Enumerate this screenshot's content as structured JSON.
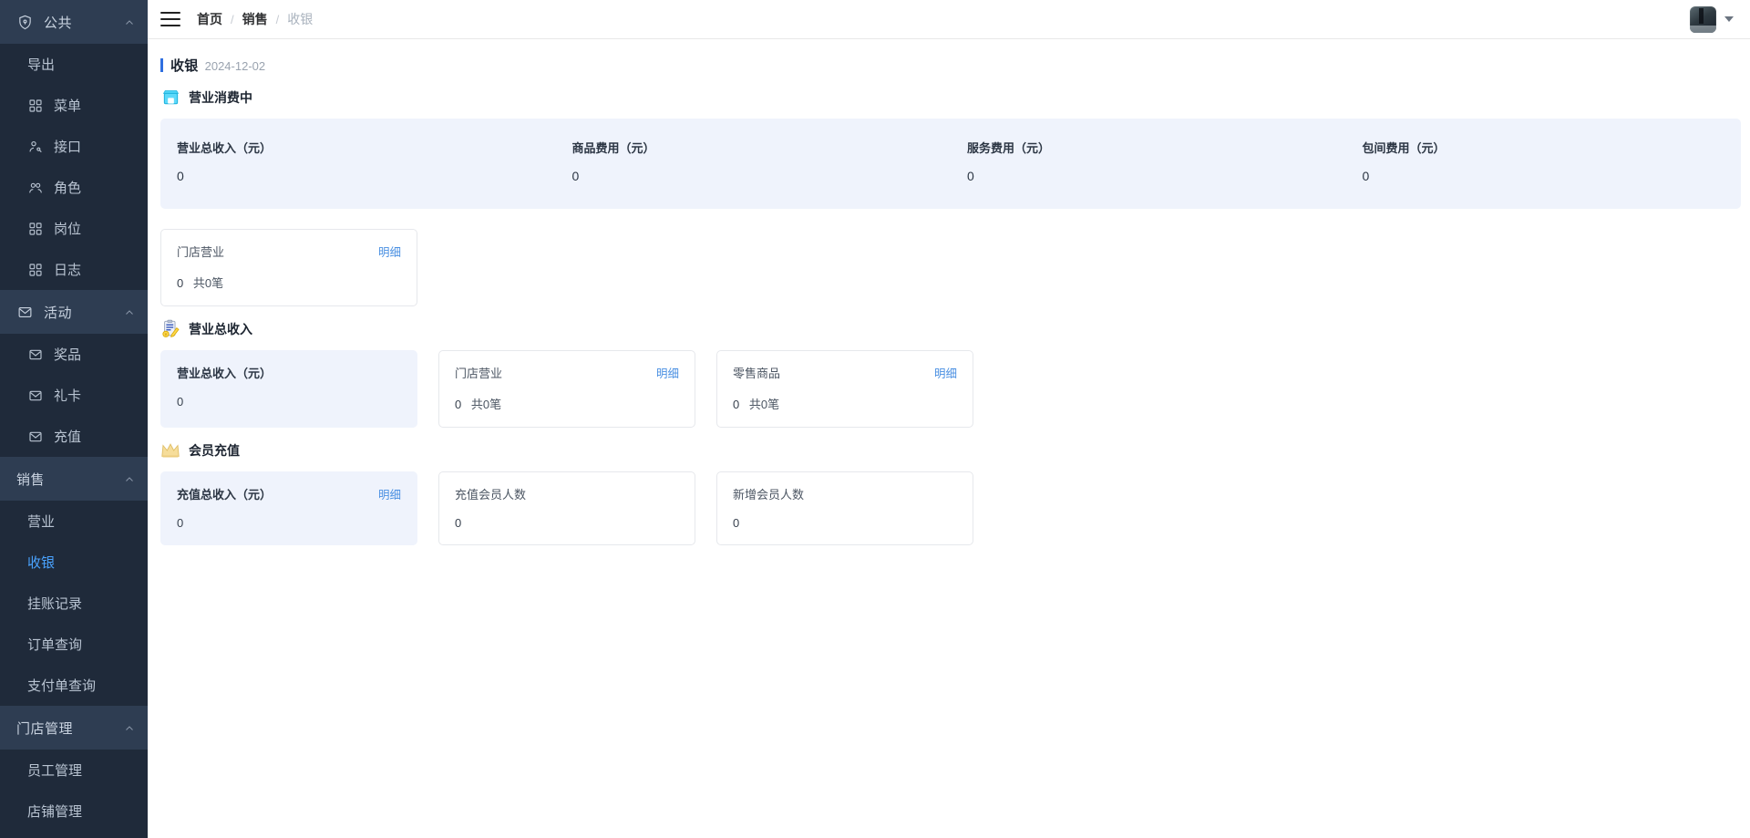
{
  "sidebar": {
    "groups": [
      {
        "id": "public",
        "label": "公共",
        "icon": "shield-icon",
        "items": [
          {
            "label": "导出",
            "icon": ""
          },
          {
            "label": "菜单",
            "icon": "grid-icon"
          },
          {
            "label": "接口",
            "icon": "user-key-icon"
          },
          {
            "label": "角色",
            "icon": "users-icon"
          },
          {
            "label": "岗位",
            "icon": "grid-icon"
          },
          {
            "label": "日志",
            "icon": "grid-icon"
          }
        ]
      },
      {
        "id": "activity",
        "label": "活动",
        "icon": "envelope-icon",
        "items": [
          {
            "label": "奖品",
            "icon": "envelope-icon"
          },
          {
            "label": "礼卡",
            "icon": "envelope-icon"
          },
          {
            "label": "充值",
            "icon": "envelope-icon"
          }
        ]
      },
      {
        "id": "sales",
        "label": "销售",
        "icon": "",
        "items": [
          {
            "label": "营业",
            "icon": ""
          },
          {
            "label": "收银",
            "icon": "",
            "active": true
          },
          {
            "label": "挂账记录",
            "icon": ""
          },
          {
            "label": "订单查询",
            "icon": ""
          },
          {
            "label": "支付单查询",
            "icon": ""
          }
        ]
      },
      {
        "id": "store",
        "label": "门店管理",
        "icon": "",
        "items": [
          {
            "label": "员工管理",
            "icon": ""
          },
          {
            "label": "店铺管理",
            "icon": ""
          }
        ]
      }
    ]
  },
  "topbar": {
    "menu_toggle": "hamburger-icon",
    "breadcrumb": [
      "首页",
      "销售",
      "收银"
    ],
    "separator": "/"
  },
  "page": {
    "title": "收银",
    "date": "2024-12-02"
  },
  "sections": {
    "consuming": {
      "title": "营业消费中",
      "icon": "store-icon",
      "summary": [
        {
          "label": "营业总收入（元）",
          "value": "0"
        },
        {
          "label": "商品费用（元）",
          "value": "0"
        },
        {
          "label": "服务费用（元）",
          "value": "0"
        },
        {
          "label": "包间费用（元）",
          "value": "0"
        }
      ],
      "cards": [
        {
          "name": "门店营业",
          "link": "明细",
          "value": "0",
          "count": "共0笔"
        }
      ]
    },
    "total_revenue": {
      "title": "营业总收入",
      "icon": "note-pencil-coin-icon",
      "cards": [
        {
          "name": "营业总收入（元）",
          "value": "0",
          "tinted": true,
          "strong": true
        },
        {
          "name": "门店营业",
          "link": "明细",
          "value": "0",
          "count": "共0笔"
        },
        {
          "name": "零售商品",
          "link": "明细",
          "value": "0",
          "count": "共0笔"
        }
      ]
    },
    "member_recharge": {
      "title": "会员充值",
      "icon": "crown-icon",
      "cards": [
        {
          "name": "充值总收入（元）",
          "link": "明细",
          "value": "0",
          "tinted": true,
          "strong": true
        },
        {
          "name": "充值会员人数",
          "value": "0"
        },
        {
          "name": "新增会员人数",
          "value": "0"
        }
      ]
    }
  }
}
